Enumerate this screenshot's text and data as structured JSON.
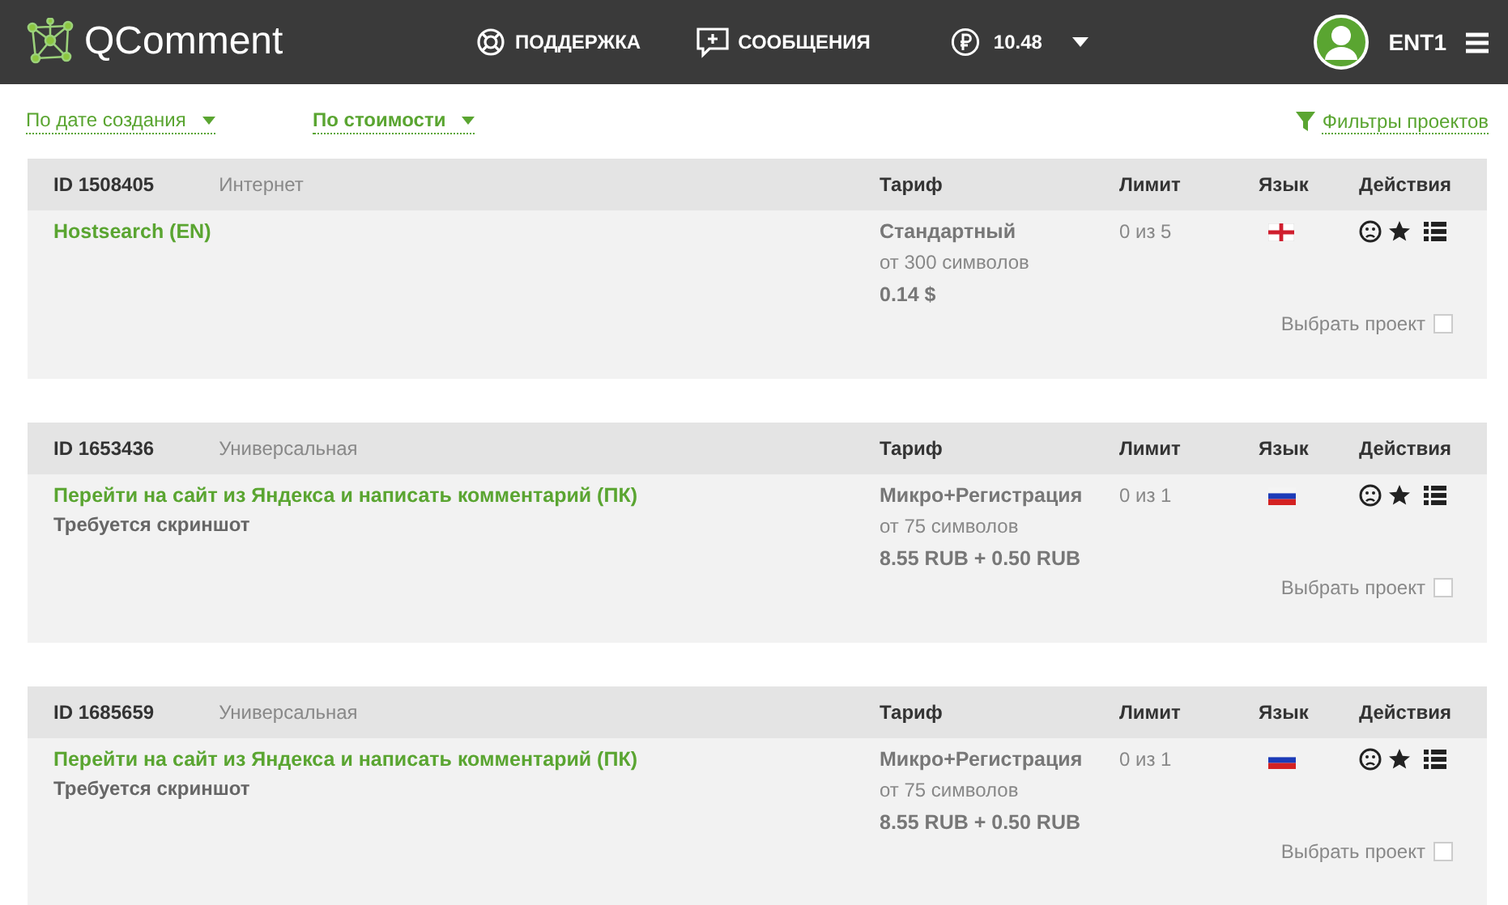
{
  "header": {
    "logo": "QComment",
    "nav": [
      {
        "kind": "support",
        "label": "ПОДДЕРЖКА"
      },
      {
        "kind": "messages",
        "label": "СООБЩЕНИЯ"
      }
    ],
    "balance": "10.48",
    "user": "ENT1"
  },
  "sort": [
    {
      "label": "По дате создания",
      "selected": false
    },
    {
      "label": "По стоимости",
      "selected": true
    }
  ],
  "filters": "Фильтры проектов",
  "projects": [
    {
      "id": "ID 1508405",
      "category": "Интернет",
      "columns": [
        "Тариф",
        "Лимит",
        "Язык",
        "Действия"
      ],
      "title": "Hostsearch (EN)",
      "tariff": "Стандартный",
      "min_length": "от 300 символов",
      "price": "0.14 $",
      "limit": "0 из 5",
      "flag": {
        "kind": "england"
      },
      "select": "Выбрать проект",
      "checked": false
    },
    {
      "id": "ID 1653436",
      "category": "Универсальная",
      "columns": [
        "Тариф",
        "Лимит",
        "Язык",
        "Действия"
      ],
      "title": "Перейти на сайт из Яндекса и написать комментарий (ПК)",
      "note": "Требуется скриншот",
      "tariff": "Микро+Регистрация",
      "min_length": "от 75 символов",
      "price": "8.55 RUB + 0.50 RUB",
      "limit": "0 из 1",
      "flag": {
        "kind": "russia"
      },
      "select": "Выбрать проект",
      "checked": false
    },
    {
      "id": "ID 1685659",
      "category": "Универсальная",
      "columns": [
        "Тариф",
        "Лимит",
        "Язык",
        "Действия"
      ],
      "title": "Перейти на сайт из Яндекса и написать комментарий (ПК)",
      "note": "Требуется скриншот",
      "tariff": "Микро+Регистрация",
      "min_length": "от 75 символов",
      "price": "8.55 RUB + 0.50 RUB",
      "limit": "0 из 1",
      "flag": {
        "kind": "russia"
      },
      "select": "Выбрать проект",
      "checked": false
    }
  ]
}
